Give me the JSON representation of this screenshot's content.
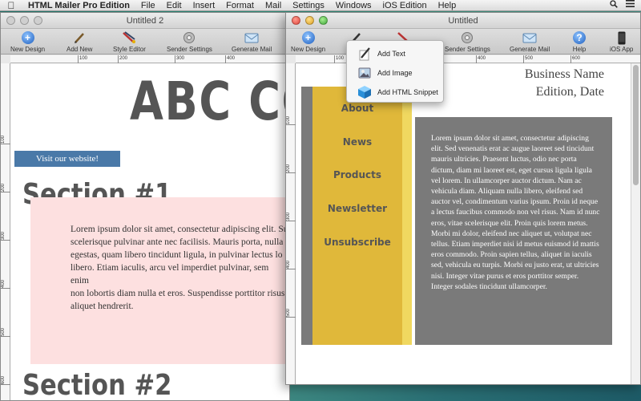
{
  "menubar": {
    "app_name": "HTML Mailer Pro Edition",
    "items": [
      "File",
      "Edit",
      "Insert",
      "Format",
      "Mail",
      "Settings",
      "Windows",
      "iOS Edition",
      "Help"
    ]
  },
  "window_back": {
    "title": "Untitled 2",
    "toolbar": [
      "New Design",
      "Add New",
      "Style Editor",
      "Sender Settings",
      "Generate Mail"
    ],
    "ruler_h": [
      "100",
      "200",
      "300",
      "400"
    ],
    "ruler_v": [
      "100",
      "200",
      "300",
      "400",
      "500",
      "600"
    ],
    "heading": "ABC CO",
    "visit_label": "Visit our website!",
    "section1": "Section #1",
    "section2": "Section #2",
    "body_text": "Lorem ipsum dolor sit amet, consectetur adipiscing elit. Su\nscelerisque pulvinar ante nec facilisis. Mauris porta, nulla\negestas, quam libero tincidunt ligula, in pulvinar lectus lo\nlibero. Etiam iaculis, arcu vel imperdiet pulvinar, sem enim\nnon lobortis diam nulla et eros. Suspendisse porttitor risus\naliquet hendrerit."
  },
  "window_front": {
    "title": "Untitled",
    "toolbar": [
      "New Design",
      "Sender Settings",
      "Generate Mail",
      "Help",
      "iOS App"
    ],
    "ruler_h": [
      "100",
      "200",
      "300",
      "400",
      "500",
      "600"
    ],
    "ruler_v": [
      "100",
      "200",
      "300",
      "400",
      "500"
    ],
    "nav": [
      "About",
      "News",
      "Products",
      "Newsletter",
      "Unsubscribe"
    ],
    "business_name": "Business Name",
    "edition": "Edition, Date",
    "body_text": "Lorem ipsum dolor sit amet, consectetur adipiscing elit. Sed venenatis erat ac augue laoreet sed tincidunt mauris ultricies. Praesent luctus, odio nec porta dictum, diam mi laoreet est, eget cursus ligula ligula vel lorem. In ullamcorper auctor dictum. Nam ac vehicula diam. Aliquam nulla libero, eleifend sed auctor vel, condimentum varius ipsum. Proin id neque a lectus faucibus commodo non vel risus. Nam id nunc eros, vitae scelerisque elit. Proin quis lorem metus. Morbi mi dolor, eleifend nec aliquet ut, volutpat nec tellus. Etiam imperdiet nisi id metus euismod id mattis eros commodo. Proin sapien tellus, aliquet in iaculis sed, vehicula eu turpis. Morbi eu justo erat, ut ultricies nisi. Integer vitae purus et eros porttitor semper. Integer sodales tincidunt ullamcorper."
  },
  "popup_menu": [
    "Add Text",
    "Add Image",
    "Add HTML Snippet"
  ],
  "colors": {
    "sidebar": "#e0b83a",
    "frame_gray": "#7a7a7a",
    "visit_button": "#4a79a8",
    "pink_box": "#fde0e0"
  }
}
